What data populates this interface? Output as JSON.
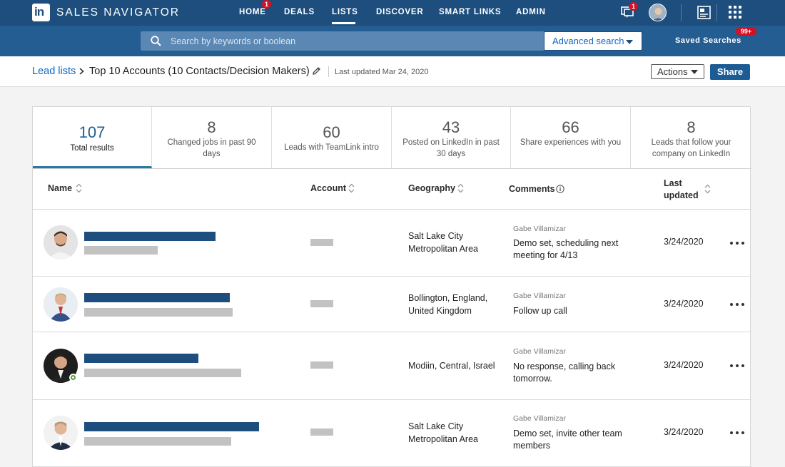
{
  "nav": {
    "brand": "SALES NAVIGATOR",
    "logo_text": "in",
    "items": [
      {
        "label": "HOME",
        "badge": "1"
      },
      {
        "label": "DEALS"
      },
      {
        "label": "LISTS"
      },
      {
        "label": "DISCOVER"
      },
      {
        "label": "SMART LINKS"
      },
      {
        "label": "ADMIN"
      }
    ],
    "active_item": "LISTS",
    "messages_badge": "1"
  },
  "search": {
    "placeholder": "Search by keywords or boolean",
    "advanced_label": "Advanced search",
    "saved_label": "Saved Searches",
    "saved_badge": "99+"
  },
  "breadcrumb": {
    "parent": "Lead lists",
    "title": "Top 10 Accounts (10 Contacts/Decision Makers)",
    "last_updated": "Last updated Mar 24, 2020",
    "actions_label": "Actions",
    "share_label": "Share"
  },
  "stats": [
    {
      "value": "107",
      "label": "Total results"
    },
    {
      "value": "8",
      "label": "Changed jobs in past 90 days"
    },
    {
      "value": "60",
      "label": "Leads with TeamLink intro"
    },
    {
      "value": "43",
      "label": "Posted on LinkedIn in past 30 days"
    },
    {
      "value": "66",
      "label": "Share experiences with you"
    },
    {
      "value": "8",
      "label": "Leads that follow your company on LinkedIn"
    }
  ],
  "table": {
    "headers": {
      "name": "Name",
      "account": "Account",
      "geography": "Geography",
      "comments": "Comments",
      "last_updated_1": "Last",
      "last_updated_2": "updated"
    },
    "rows": [
      {
        "geo_1": "Salt Lake City",
        "geo_2": "Metropolitan Area",
        "commenter": "Gabe Villamizar",
        "comment": "Demo set, scheduling next meeting for 4/13",
        "updated": "3/24/2020"
      },
      {
        "geo_1": "Bollington, England,",
        "geo_2": "United Kingdom",
        "commenter": "Gabe Villamizar",
        "comment": "Follow up call",
        "updated": "3/24/2020"
      },
      {
        "geo_1": "Modiin, Central, Israel",
        "geo_2": "",
        "commenter": "Gabe Villamizar",
        "comment": "No response, calling back tomorrow.",
        "updated": "3/24/2020"
      },
      {
        "geo_1": "Salt Lake City",
        "geo_2": "Metropolitan Area",
        "commenter": "Gabe Villamizar",
        "comment": "Demo set, invite other team members",
        "updated": "3/24/2020"
      }
    ]
  },
  "colors": {
    "nav_bg": "#1d4e7d",
    "search_row_bg": "#245d92",
    "link_blue": "#0a66c2",
    "badge_red": "#d11124",
    "active_tab": "#2a77a8"
  }
}
